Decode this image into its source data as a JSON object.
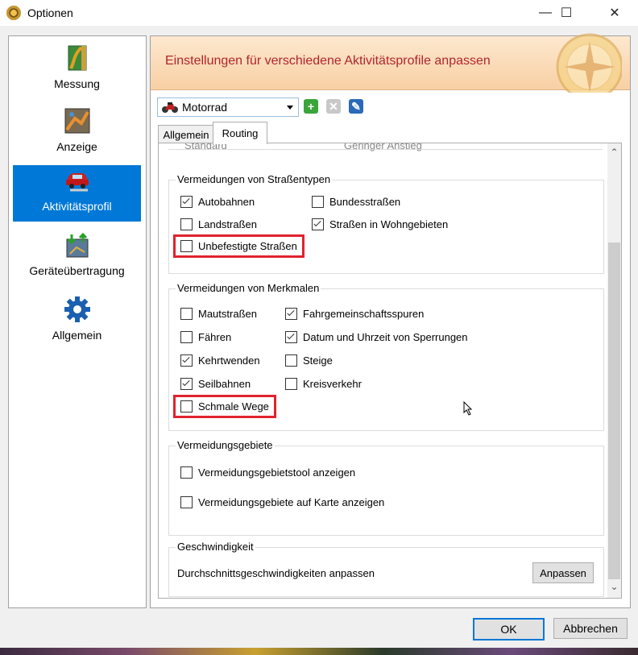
{
  "window": {
    "title": "Optionen",
    "minimize": "—",
    "maximize": "☐",
    "close": "✕"
  },
  "nav": {
    "items": [
      {
        "label": "Messung",
        "icon": "ruler-map-icon",
        "active": false
      },
      {
        "label": "Anzeige",
        "icon": "map-display-icon",
        "active": false
      },
      {
        "label": "Aktivitätsprofil",
        "icon": "car-icon",
        "active": true
      },
      {
        "label": "Geräteübertragung",
        "icon": "device-transfer-icon",
        "active": false
      },
      {
        "label": "Allgemein",
        "icon": "gear-icon",
        "active": false
      }
    ]
  },
  "banner": {
    "text": "Einstellungen für verschiedene Aktivitätsprofile anpassen"
  },
  "profile": {
    "selected": "Motorrad",
    "add": "+",
    "remove": "✕",
    "edit": "✎"
  },
  "tabs": [
    {
      "label": "Allgemein",
      "active": false
    },
    {
      "label": "Routing",
      "active": true
    }
  ],
  "partial_row": {
    "left": "Standard",
    "right": "Geringer Anstieg"
  },
  "groups": {
    "strassentypen": {
      "title": "Vermeidungen von Straßentypen",
      "items": [
        {
          "label": "Autobahnen",
          "checked": true
        },
        {
          "label": "Bundesstraßen",
          "checked": false
        },
        {
          "label": "Landstraßen",
          "checked": false
        },
        {
          "label": "Straßen in Wohngebieten",
          "checked": true
        },
        {
          "label": "Unbefestigte Straßen",
          "checked": false,
          "highlighted": true
        }
      ]
    },
    "merkmale": {
      "title": "Vermeidungen von Merkmalen",
      "items": [
        {
          "label": "Mautstraßen",
          "checked": false
        },
        {
          "label": "Fahrgemeinschaftsspuren",
          "checked": true
        },
        {
          "label": "Fähren",
          "checked": false
        },
        {
          "label": "Datum und Uhrzeit von Sperrungen",
          "checked": true
        },
        {
          "label": "Kehrtwenden",
          "checked": true
        },
        {
          "label": "Steige",
          "checked": false
        },
        {
          "label": "Seilbahnen",
          "checked": true
        },
        {
          "label": "Kreisverkehr",
          "checked": false
        },
        {
          "label": "Schmale Wege",
          "checked": false,
          "highlighted": true
        }
      ]
    },
    "gebiete": {
      "title": "Vermeidungsgebiete",
      "items": [
        {
          "label": "Vermeidungsgebietstool anzeigen",
          "checked": false
        },
        {
          "label": "Vermeidungsgebiete auf Karte anzeigen",
          "checked": false
        }
      ]
    },
    "geschwindigkeit": {
      "title": "Geschwindigkeit",
      "text": "Durchschnittsgeschwindigkeiten anpassen",
      "button": "Anpassen"
    }
  },
  "buttons": {
    "ok": "OK",
    "cancel": "Abbrechen"
  },
  "colors": {
    "accent": "#0078d7",
    "banner_text": "#b2252b",
    "highlight": "#e0232e",
    "add": "#3aa53a"
  }
}
